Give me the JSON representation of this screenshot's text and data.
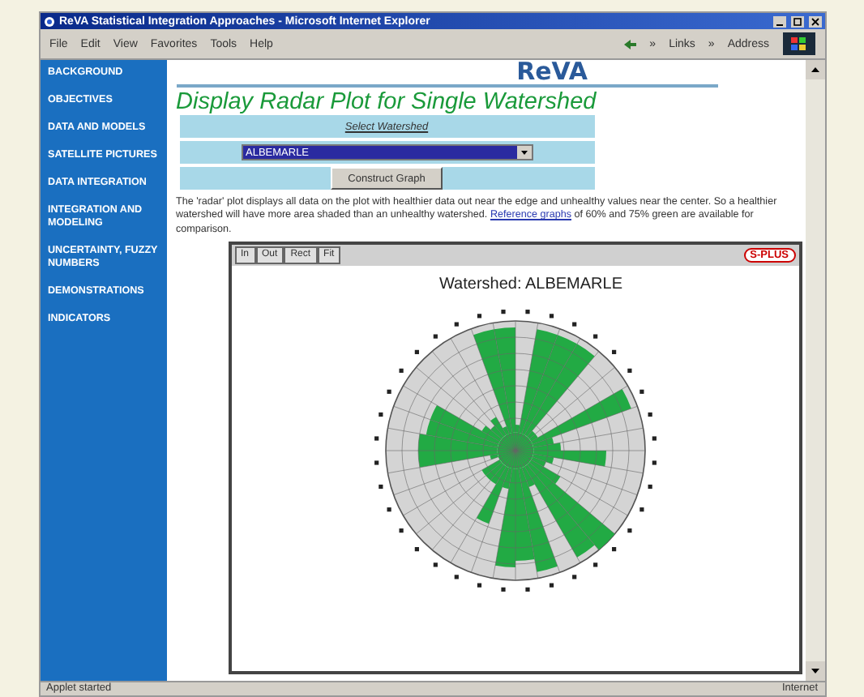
{
  "window": {
    "title": "ReVA Statistical Integration Approaches - Microsoft Internet Explorer"
  },
  "menu": [
    "File",
    "Edit",
    "View",
    "Favorites",
    "Tools",
    "Help"
  ],
  "toolbar": {
    "chevron_1": "»",
    "links": "Links",
    "chevron_2": "»",
    "address": "Address"
  },
  "sidebar": {
    "items": [
      {
        "label": "BACKGROUND"
      },
      {
        "label": "OBJECTIVES"
      },
      {
        "label": "DATA AND MODELS"
      },
      {
        "label": "SATELLITE PICTURES"
      },
      {
        "label": "DATA INTEGRATION"
      },
      {
        "label": "INTEGRATION AND MODELING"
      },
      {
        "label": "UNCERTAINTY, FUZZY NUMBERS"
      },
      {
        "label": "DEMONSTRATIONS"
      },
      {
        "label": "INDICATORS"
      }
    ]
  },
  "logo": "ReVA",
  "heading": "Display Radar Plot for Single Watershed",
  "form": {
    "label": "Select Watershed",
    "select_value": "ALBEMARLE",
    "button": "Construct Graph"
  },
  "description": {
    "text_before": "The 'radar' plot displays all data on the plot with healthier data out near the edge and unhealthy values near the center. So a healthier watershed will have more area shaded than an unhealthy watershed. ",
    "link": "Reference graphs",
    "text_after": " of 60% and 75% green are available for comparison."
  },
  "graph": {
    "tools": [
      "In",
      "Out",
      "Rect",
      "Fit"
    ],
    "badge": "S-PLUS",
    "title": "Watershed:  ALBEMARLE"
  },
  "status_bar": {
    "text": "Applet started",
    "zone": "Internet"
  }
}
